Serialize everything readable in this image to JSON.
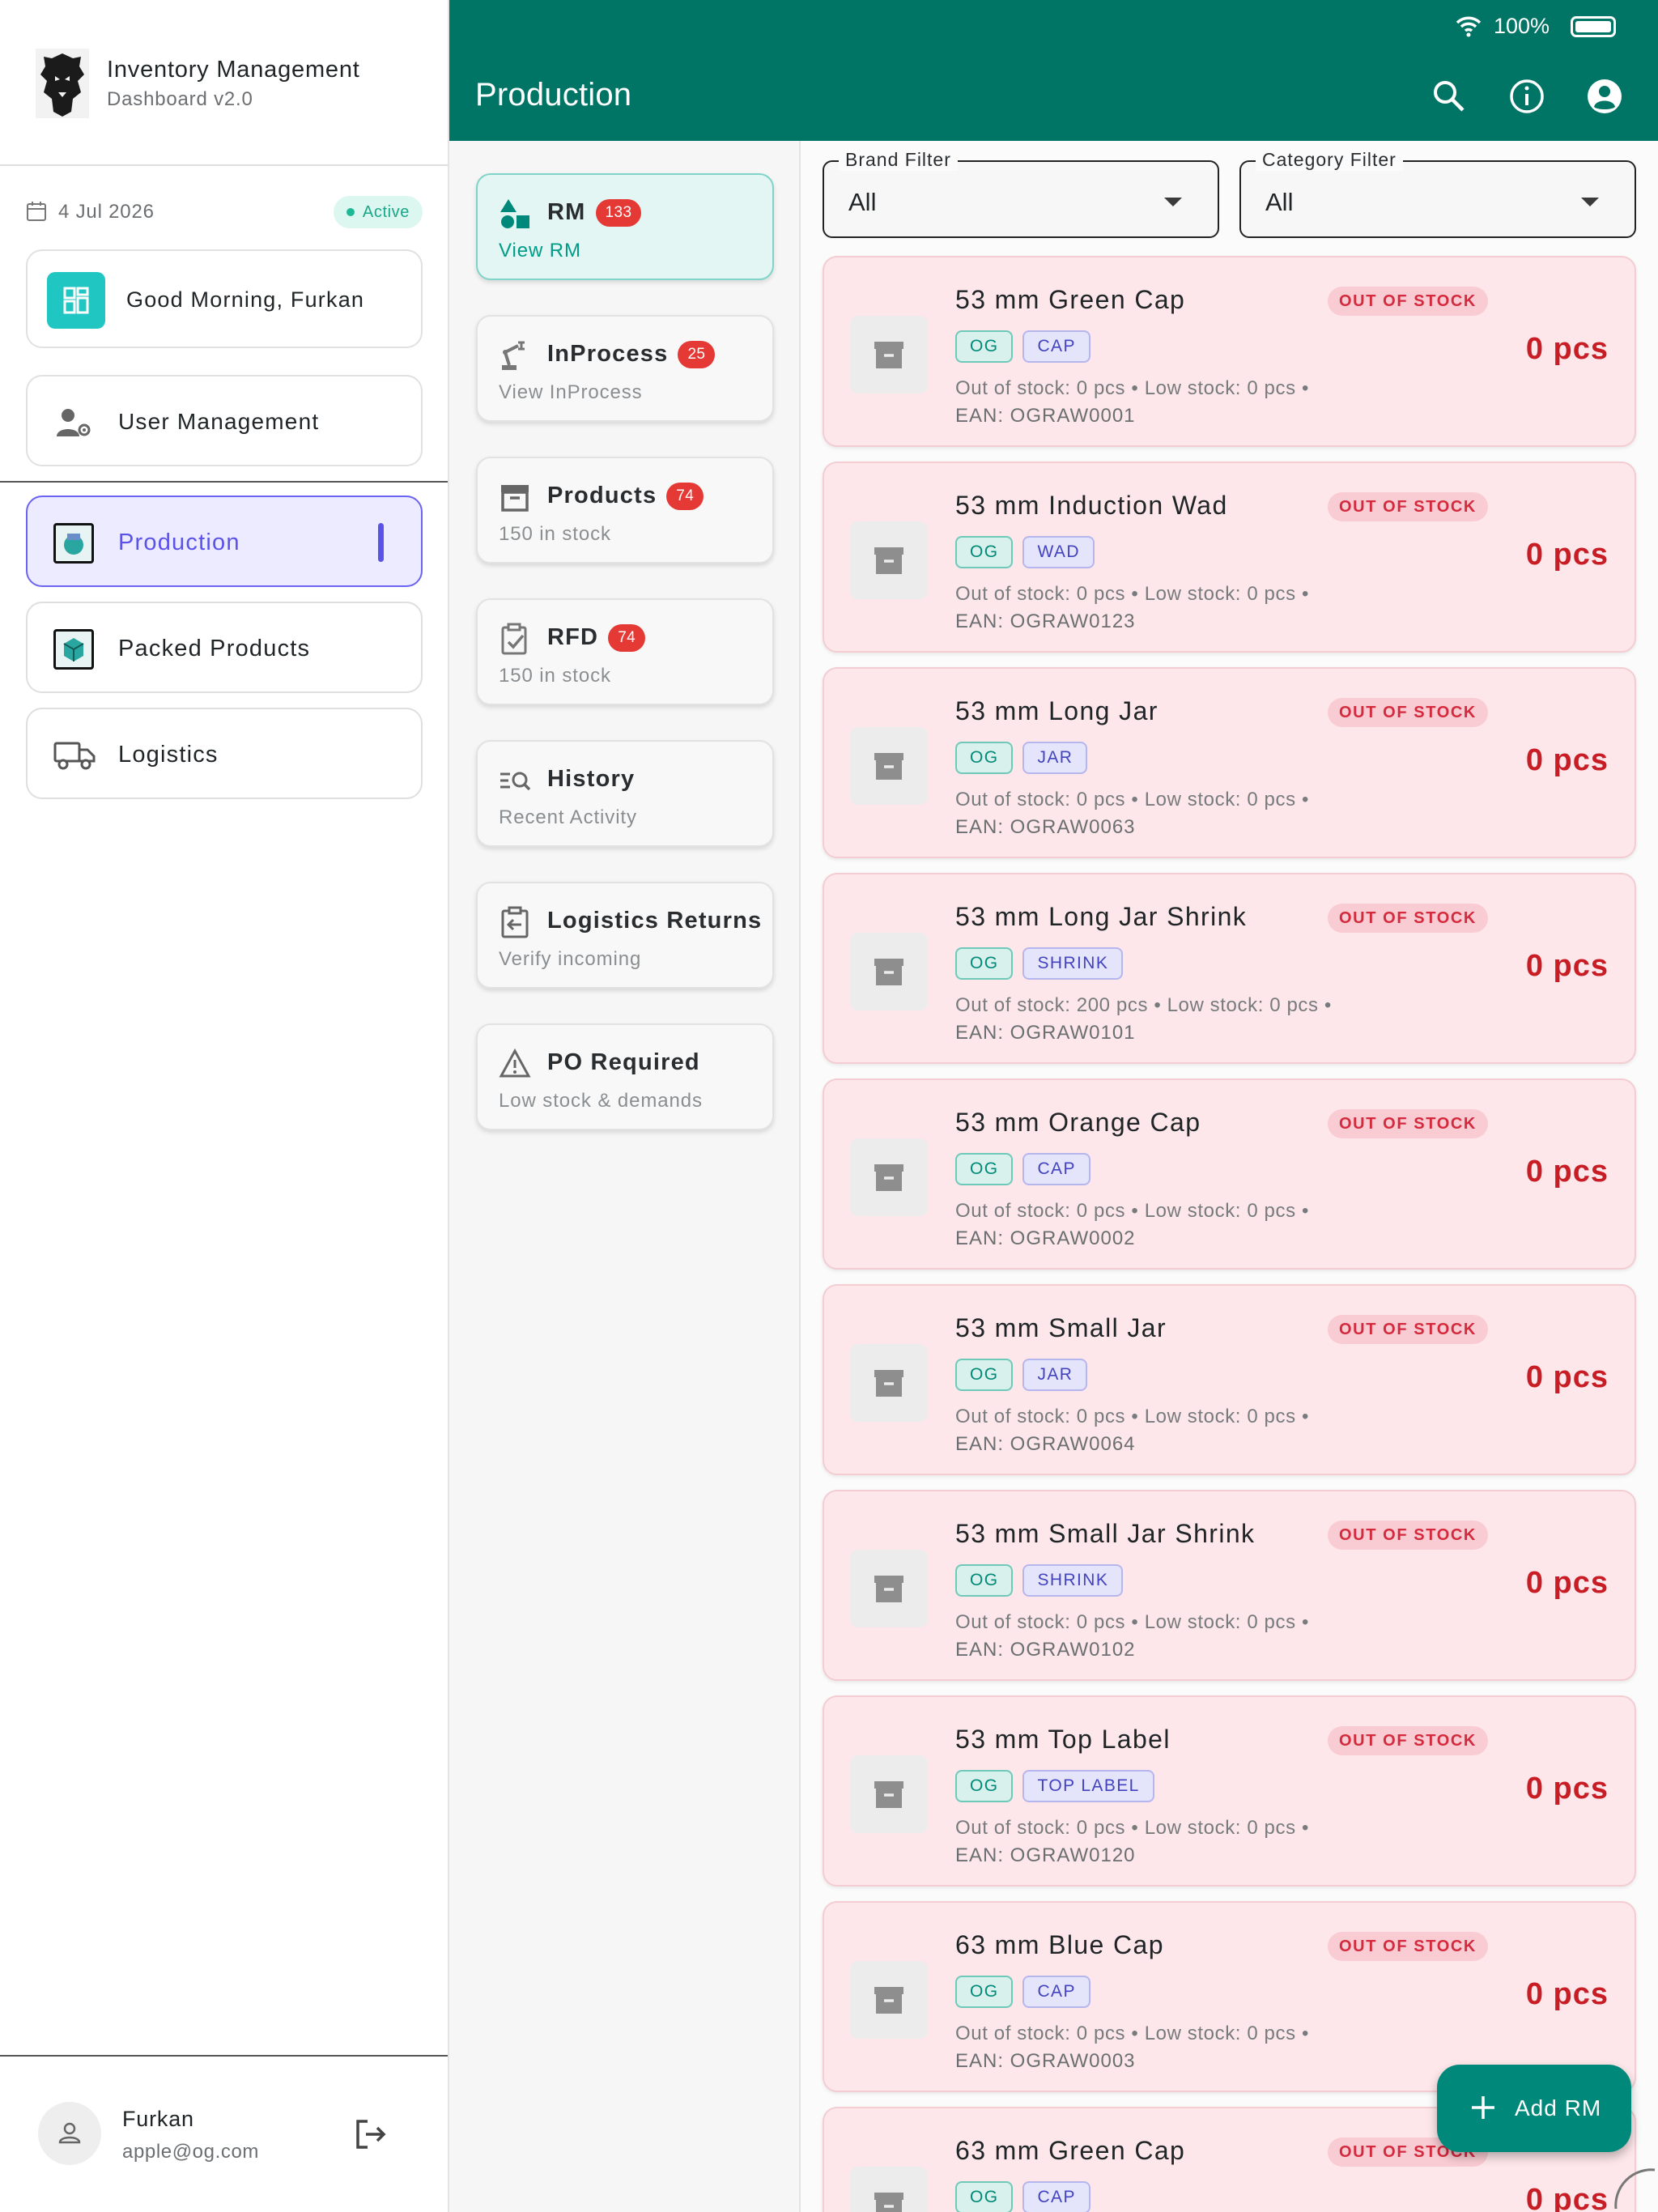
{
  "status_bar": {
    "battery": "100%"
  },
  "brand": {
    "title": "Inventory Management",
    "subtitle": "Dashboard v2.0"
  },
  "sidebar": {
    "date": "4 Jul 2026",
    "status": "Active",
    "greeting": "Good Morning, Furkan",
    "user_management": "User Management",
    "nav": [
      {
        "label": "Production",
        "active": true
      },
      {
        "label": "Packed Products",
        "active": false
      },
      {
        "label": "Logistics",
        "active": false
      }
    ],
    "user": {
      "name": "Furkan",
      "email": "apple@og.com"
    }
  },
  "appbar": {
    "title": "Production"
  },
  "menu": [
    {
      "title": "RM",
      "badge": "133",
      "subtitle": "View RM",
      "icon": "shapes-icon",
      "active": true
    },
    {
      "title": "InProcess",
      "badge": "25",
      "subtitle": "View InProcess",
      "icon": "robot-arm-icon",
      "active": false
    },
    {
      "title": "Products",
      "badge": "74",
      "subtitle": "150 in stock",
      "icon": "archive-icon",
      "active": false
    },
    {
      "title": "RFD",
      "badge": "74",
      "subtitle": "150 in stock",
      "icon": "clipboard-check-icon",
      "active": false
    },
    {
      "title": "History",
      "badge": "",
      "subtitle": "Recent Activity",
      "icon": "list-search-icon",
      "active": false
    },
    {
      "title": "Logistics Returns",
      "badge": "",
      "subtitle": "Verify incoming",
      "icon": "return-box-icon",
      "active": false
    },
    {
      "title": "PO Required",
      "badge": "",
      "subtitle": "Low stock & demands",
      "icon": "warning-icon",
      "active": false
    }
  ],
  "filters": {
    "brand": {
      "label": "Brand Filter",
      "value": "All"
    },
    "category": {
      "label": "Category Filter",
      "value": "All"
    }
  },
  "items": [
    {
      "name": "53 mm Green Cap",
      "status": "OUT OF STOCK",
      "brand": "OG",
      "type": "CAP",
      "stats": "Out of stock: 0 pcs  •  Low stock: 0 pcs  •",
      "ean": "EAN: OGRAW0001",
      "qty": "0 pcs"
    },
    {
      "name": "53 mm Induction Wad",
      "status": "OUT OF STOCK",
      "brand": "OG",
      "type": "WAD",
      "stats": "Out of stock: 0 pcs  •  Low stock: 0 pcs  •",
      "ean": "EAN: OGRAW0123",
      "qty": "0 pcs"
    },
    {
      "name": "53 mm Long Jar",
      "status": "OUT OF STOCK",
      "brand": "OG",
      "type": "JAR",
      "stats": "Out of stock: 0 pcs  •  Low stock: 0 pcs  •",
      "ean": "EAN: OGRAW0063",
      "qty": "0 pcs"
    },
    {
      "name": "53 mm Long Jar Shrink",
      "status": "OUT OF STOCK",
      "brand": "OG",
      "type": "SHRINK",
      "stats": "Out of stock: 200 pcs  •  Low stock: 0 pcs  •",
      "ean": "EAN: OGRAW0101",
      "qty": "0 pcs"
    },
    {
      "name": "53 mm Orange Cap",
      "status": "OUT OF STOCK",
      "brand": "OG",
      "type": "CAP",
      "stats": "Out of stock: 0 pcs  •  Low stock: 0 pcs  •",
      "ean": "EAN: OGRAW0002",
      "qty": "0 pcs"
    },
    {
      "name": "53 mm Small Jar",
      "status": "OUT OF STOCK",
      "brand": "OG",
      "type": "JAR",
      "stats": "Out of stock: 0 pcs  •  Low stock: 0 pcs  •",
      "ean": "EAN: OGRAW0064",
      "qty": "0 pcs"
    },
    {
      "name": "53 mm Small Jar Shrink",
      "status": "OUT OF STOCK",
      "brand": "OG",
      "type": "SHRINK",
      "stats": "Out of stock: 0 pcs  •  Low stock: 0 pcs  •",
      "ean": "EAN: OGRAW0102",
      "qty": "0 pcs"
    },
    {
      "name": "53 mm Top Label",
      "status": "OUT OF STOCK",
      "brand": "OG",
      "type": "TOP LABEL",
      "stats": "Out of stock: 0 pcs  •  Low stock: 0 pcs  •",
      "ean": "EAN: OGRAW0120",
      "qty": "0 pcs"
    },
    {
      "name": "63 mm Blue Cap",
      "status": "OUT OF STOCK",
      "brand": "OG",
      "type": "CAP",
      "stats": "Out of stock: 0 pcs  •  Low stock: 0 pcs  •",
      "ean": "EAN: OGRAW0003",
      "qty": "0 pcs"
    },
    {
      "name": "63 mm Green  Cap",
      "status": "OUT OF STOCK",
      "brand": "OG",
      "type": "CAP",
      "stats": "",
      "ean": "",
      "qty": "0 pcs"
    }
  ],
  "fab": {
    "label": "Add RM",
    "icon": "plus-icon"
  },
  "colors": {
    "primary": "#007566",
    "accent": "#5b52e8",
    "danger": "#c81d25",
    "card_bg": "#fde7ea",
    "badge": "#e53935"
  }
}
